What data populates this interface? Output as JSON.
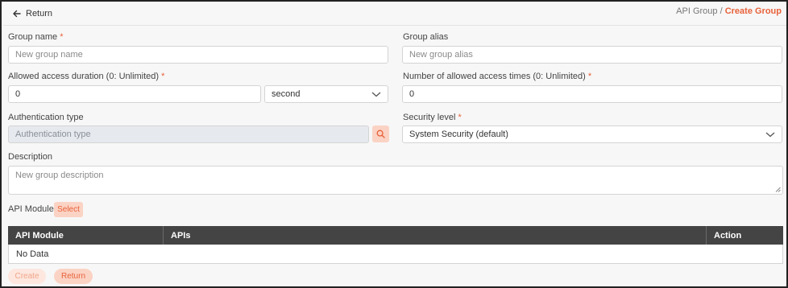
{
  "header": {
    "return_label": "Return",
    "breadcrumb_parent": "API Group",
    "breadcrumb_separator": "/",
    "breadcrumb_current": "Create Group"
  },
  "form": {
    "group_name": {
      "label": "Group name",
      "required": "*",
      "placeholder": "New group name"
    },
    "group_alias": {
      "label": "Group alias",
      "placeholder": "New group alias"
    },
    "duration": {
      "label": "Allowed access duration (0: Unlimited)",
      "required": "*",
      "value": "0",
      "unit_value": "second"
    },
    "access_times": {
      "label": "Number of allowed access times (0: Unlimited)",
      "required": "*",
      "value": "0"
    },
    "auth_type": {
      "label": "Authentication type",
      "placeholder": "Authentication type"
    },
    "security_level": {
      "label": "Security level",
      "required": "*",
      "value": "System Security (default)"
    },
    "description": {
      "label": "Description",
      "placeholder": "New group description"
    }
  },
  "api_module": {
    "label": "API Module",
    "select_label": "Select",
    "table": {
      "columns": [
        "API Module",
        "APIs",
        "Action"
      ],
      "empty_text": "No Data"
    }
  },
  "footer": {
    "create_label": "Create",
    "return_label": "Return"
  },
  "colors": {
    "accent": "#e8613a",
    "accent_light": "#fbd3c4",
    "table_header": "#444444"
  },
  "icons": {
    "return": "arrow-left-icon",
    "search": "search-icon",
    "dropdown": "chevron-down-icon"
  }
}
